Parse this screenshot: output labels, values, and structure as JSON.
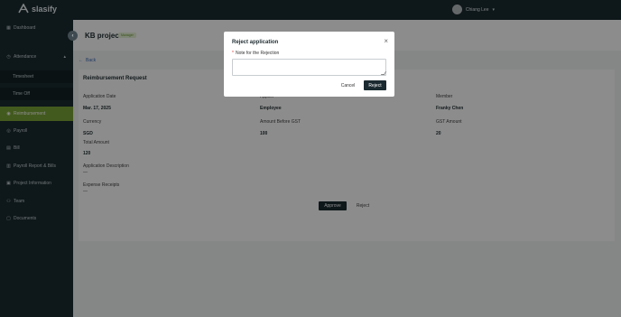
{
  "app": {
    "logo_text": "slasify"
  },
  "user": {
    "name": "Chiang Lee"
  },
  "sidebar": {
    "items": [
      {
        "label": "Dashboard",
        "icon": "dashboard-icon"
      },
      {
        "label": "Attendance",
        "icon": "attendance-icon"
      },
      {
        "label": "Timesheet"
      },
      {
        "label": "Time Off"
      },
      {
        "label": "Reimbursement",
        "icon": "reimbursement-icon"
      },
      {
        "label": "Payroll",
        "icon": "payroll-icon"
      },
      {
        "label": "Bill",
        "icon": "bill-icon"
      },
      {
        "label": "Payroll Report & Bills",
        "icon": "report-icon"
      },
      {
        "label": "Project Information",
        "icon": "project-icon"
      },
      {
        "label": "Team",
        "icon": "team-icon"
      },
      {
        "label": "Documents",
        "icon": "documents-icon"
      }
    ]
  },
  "page": {
    "title": "KB project",
    "badge": "Manager",
    "back_label": "Back",
    "card_title": "Reimbursement Request",
    "fields": {
      "application_date_label": "Application Date",
      "application_date_value": "Mar. 17, 2025",
      "applier_label": "Applier",
      "applier_value": "Employee",
      "member_label": "Member",
      "member_value": "Franky Chen",
      "currency_label": "Currency",
      "currency_value": "SGD",
      "amount_before_gst_label": "Amount Before GST",
      "amount_before_gst_value": "100",
      "gst_amount_label": "GST Amount",
      "gst_amount_value": "20",
      "total_amount_label": "Total Amount",
      "total_amount_value": "120",
      "description_label": "Application Description",
      "description_value": "—",
      "receipts_label": "Expense Receipts",
      "receipts_value": "—"
    },
    "approve_label": "Approve",
    "reject_label": "Reject"
  },
  "modal": {
    "title": "Reject application",
    "field_label": "Note for the Rejection",
    "required_mark": "*",
    "note_value": "",
    "cancel_label": "Cancel",
    "reject_label": "Reject"
  },
  "colors": {
    "sidebar_bg": "#1a2a30",
    "active_item": "#7aa437",
    "primary_button": "#1b2a30"
  }
}
